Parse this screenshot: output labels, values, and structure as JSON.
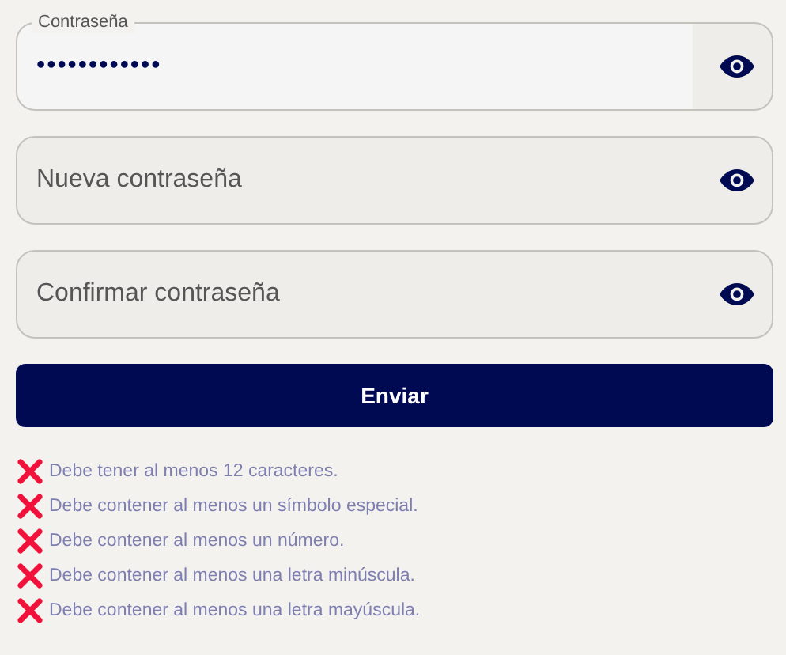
{
  "fields": [
    {
      "label": "Contraseña",
      "value": "••••••••••••"
    },
    {
      "placeholder": "Nueva contraseña"
    },
    {
      "placeholder": "Confirmar contraseña"
    }
  ],
  "submit": "Enviar",
  "rules": [
    {
      "text": "Debe tener al menos 12 caracteres.",
      "met": false
    },
    {
      "text": "Debe contener al menos un símbolo especial.",
      "met": false
    },
    {
      "text": "Debe contener al menos un número.",
      "met": false
    },
    {
      "text": "Debe contener al menos una letra minúscula.",
      "met": false
    },
    {
      "text": "Debe contener al menos una letra mayúscula.",
      "met": false
    }
  ]
}
